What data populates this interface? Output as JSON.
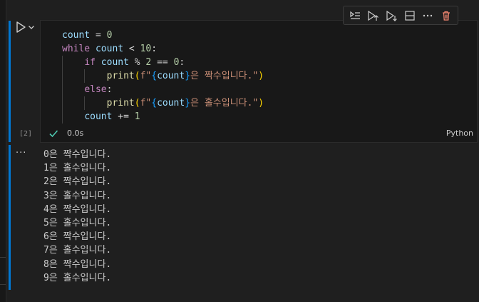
{
  "cell": {
    "execution_count": "[2]",
    "exec_time": "0.0s",
    "language": "Python",
    "code": {
      "l1": {
        "a": "count",
        "b": " = ",
        "c": "0"
      },
      "l2": {
        "kw": "while",
        "a": " count",
        "b": " < ",
        "c": "10",
        "d": ":"
      },
      "l3": {
        "kw": "if",
        "a": " count",
        "b": " % ",
        "c": "2",
        "d": " == ",
        "e": "0",
        "f": ":"
      },
      "l4": {
        "fn": "print",
        "p1": "(",
        "s1": "f\"",
        "b1": "{",
        "v": "count",
        "b2": "}",
        "s2": "은 짝수입니다.\"",
        "p2": ")"
      },
      "l5": {
        "kw": "else",
        "f": ":"
      },
      "l6": {
        "fn": "print",
        "p1": "(",
        "s1": "f\"",
        "b1": "{",
        "v": "count",
        "b2": "}",
        "s2": "은 홀수입니다.\"",
        "p2": ")"
      },
      "l7": {
        "a": "count",
        "b": " += ",
        "c": "1"
      }
    }
  },
  "toolbar": {
    "icons": [
      "run-by-line-icon",
      "execute-above-icon",
      "execute-below-icon",
      "split-cell-icon",
      "more-actions-icon",
      "delete-cell-icon"
    ]
  },
  "output": {
    "menu": "···",
    "lines": [
      "0은 짝수입니다.",
      "1은 홀수입니다.",
      "2은 짝수입니다.",
      "3은 홀수입니다.",
      "4은 짝수입니다.",
      "5은 홀수입니다.",
      "6은 짝수입니다.",
      "7은 홀수입니다.",
      "8은 짝수입니다.",
      "9은 홀수입니다."
    ]
  },
  "colors": {
    "accent": "#0078d4",
    "keyword": "#c586c0",
    "variable": "#9cdcfe",
    "number": "#b5cea8",
    "function": "#dcdcaa",
    "string": "#ce9178",
    "success": "#4ec9b0"
  }
}
